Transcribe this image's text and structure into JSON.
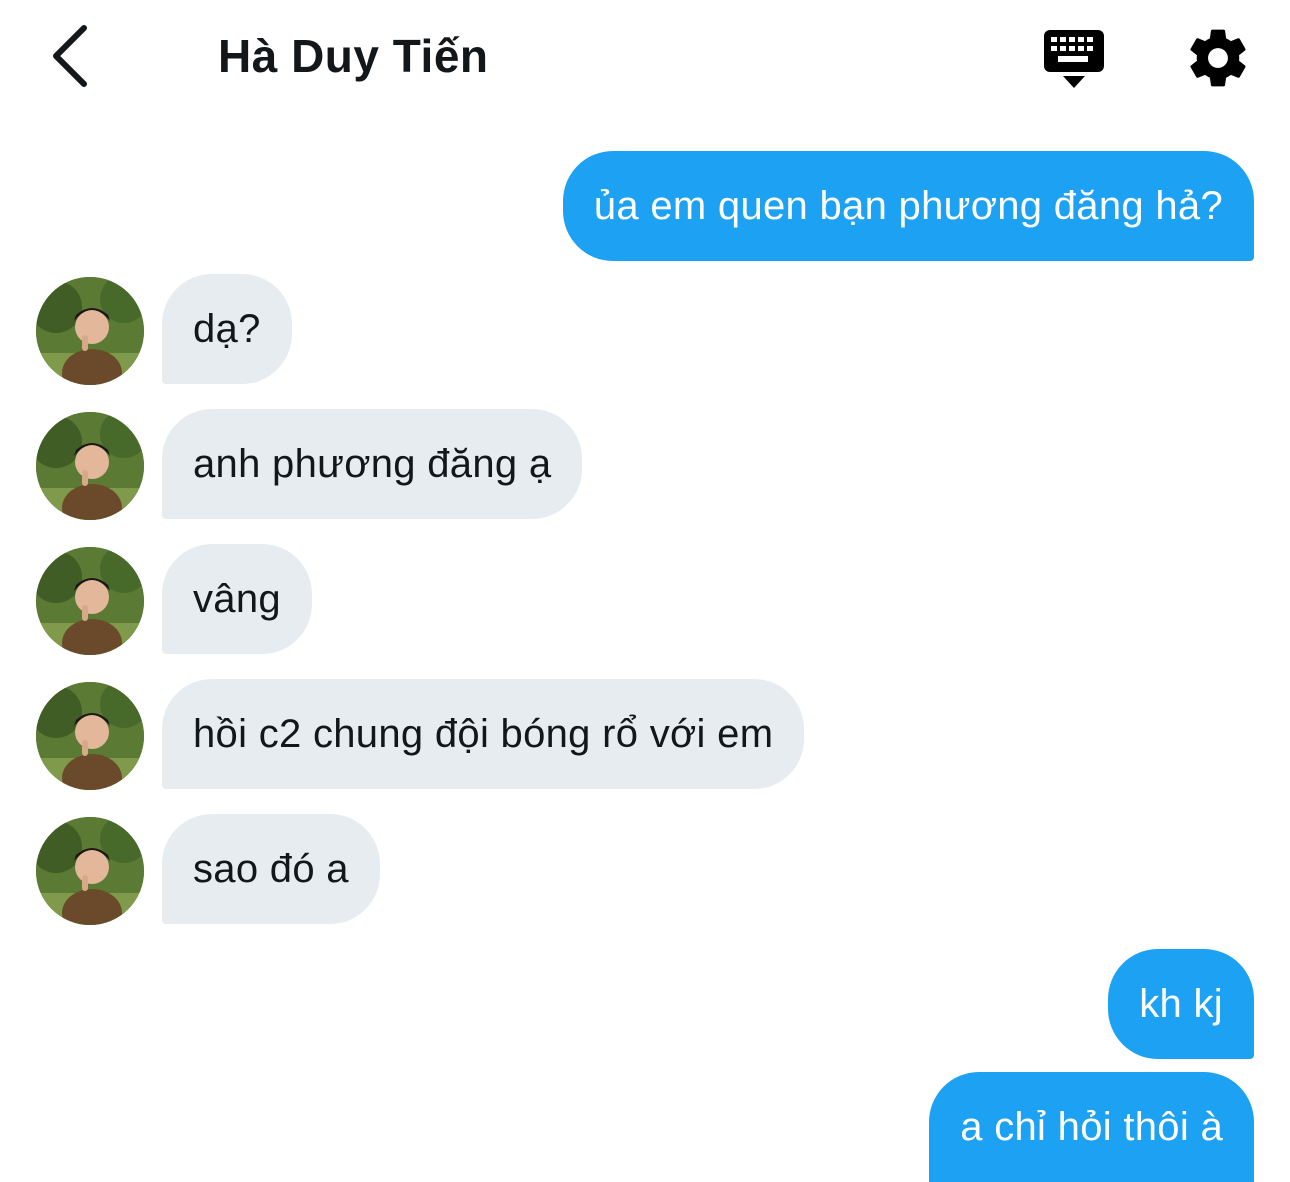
{
  "header": {
    "title": "Hà Duy Tiến",
    "back_icon": "chevron-left-icon",
    "keyboard_icon": "keyboard-icon",
    "settings_icon": "gear-icon"
  },
  "colors": {
    "outgoing_bubble": "#1da1f2",
    "incoming_bubble": "#e6ecf0",
    "text": "#14171a"
  },
  "messages": [
    {
      "direction": "outgoing",
      "text": "ủa em quen bạn phương đăng hả?"
    },
    {
      "direction": "incoming",
      "text": "dạ?"
    },
    {
      "direction": "incoming",
      "text": "anh phương đăng ạ"
    },
    {
      "direction": "incoming",
      "text": "vâng"
    },
    {
      "direction": "incoming",
      "text": "hồi c2 chung đội bóng rổ với em"
    },
    {
      "direction": "incoming",
      "text": "sao đó a"
    },
    {
      "direction": "outgoing",
      "text": "kh kj"
    },
    {
      "direction": "outgoing",
      "text": "a chỉ hỏi thôi à"
    }
  ]
}
